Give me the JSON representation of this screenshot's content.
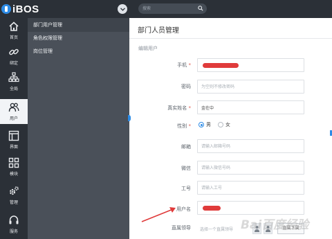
{
  "app": {
    "logo_text": "iBOS"
  },
  "search": {
    "placeholder": "搜索"
  },
  "iconbar": {
    "items": [
      {
        "label": "首页",
        "icon": "home-icon"
      },
      {
        "label": "绑定",
        "icon": "link-icon"
      },
      {
        "label": "全局",
        "icon": "org-chart-icon"
      },
      {
        "label": "用户",
        "icon": "users-icon",
        "active": true
      },
      {
        "label": "界面",
        "icon": "layout-icon"
      },
      {
        "label": "模块",
        "icon": "grid-icon"
      },
      {
        "label": "管理",
        "icon": "gears-icon"
      },
      {
        "label": "服务",
        "icon": "headset-icon"
      }
    ]
  },
  "submenu": {
    "items": [
      {
        "label": "部门用户管理",
        "active": true
      },
      {
        "label": "角色权限管理"
      },
      {
        "label": "岗位管理"
      }
    ]
  },
  "main": {
    "title": "部门人员管理",
    "section": "编辑用户",
    "form": {
      "mobile_label": "手机",
      "password_label": "密码",
      "password_placeholder": "为空则不修改密码",
      "realname_label": "真实姓名",
      "realname_value": "金在中",
      "gender_label": "性别",
      "gender_male": "男",
      "gender_female": "女",
      "gender_selected": "男",
      "email_label": "邮箱",
      "email_placeholder": "请输入邮箱号码",
      "wechat_label": "微信",
      "wechat_placeholder": "请输入微信号码",
      "jobno_label": "工号",
      "jobno_placeholder": "请输入工号",
      "username_label": "用户名",
      "superior_label": "直属领导",
      "superior_placeholder": "选择一个直属领导",
      "superior_filter": "直属下属"
    }
  },
  "watermark": {
    "text": "Bai百度经验"
  },
  "colors": {
    "accent": "#2c8be6",
    "sidebar": "#2b3037",
    "submenu": "#4a5059",
    "redact": "#e03b3b",
    "annotation_arrow": "#e03b3b"
  }
}
